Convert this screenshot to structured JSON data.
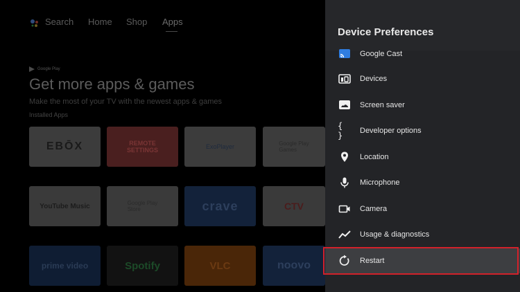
{
  "background": {
    "nav": {
      "search_label": "Search",
      "home_label": "Home",
      "shop_label": "Shop",
      "apps_label": "Apps"
    },
    "promo": {
      "google_play_label": "Google Play",
      "title": "Get more apps & games",
      "subtitle": "Make the most of your TV with the newest apps & games",
      "installed_label": "Installed Apps"
    },
    "tiles": [
      {
        "name": "ebox",
        "label": "EBŌX"
      },
      {
        "name": "remote-settings",
        "label": "REMOTE\nSETTINGS"
      },
      {
        "name": "exoplayer",
        "label": "ExoPlayer"
      },
      {
        "name": "google-play-games",
        "label": "Google Play\nGames"
      },
      {
        "name": "youtube-music",
        "label": "YouTube Music"
      },
      {
        "name": "google-play-store",
        "label": "Google Play\nStore"
      },
      {
        "name": "crave",
        "label": "crave"
      },
      {
        "name": "ctv",
        "label": "CTV"
      },
      {
        "name": "prime-video",
        "label": "prime video"
      },
      {
        "name": "spotify",
        "label": "Spotify"
      },
      {
        "name": "vlc",
        "label": "VLC"
      },
      {
        "name": "noovo",
        "label": "noovo"
      }
    ]
  },
  "panel": {
    "title": "Device Preferences",
    "items": [
      {
        "label": "Google Cast",
        "icon": "cast-icon"
      },
      {
        "label": "Devices",
        "icon": "devices-icon"
      },
      {
        "label": "Screen saver",
        "icon": "screen-saver-icon"
      },
      {
        "label": "Developer options",
        "icon": "braces-icon"
      },
      {
        "label": "Location",
        "icon": "location-pin-icon"
      },
      {
        "label": "Microphone",
        "icon": "microphone-icon"
      },
      {
        "label": "Camera",
        "icon": "camera-icon"
      },
      {
        "label": "Usage & diagnostics",
        "icon": "trend-line-icon"
      },
      {
        "label": "Restart",
        "icon": "restart-icon"
      }
    ],
    "selected_item": "Restart",
    "colors": {
      "panel_bg": "#232427",
      "selected_bg": "#3d3e41",
      "highlight_border": "#d3212a"
    }
  }
}
